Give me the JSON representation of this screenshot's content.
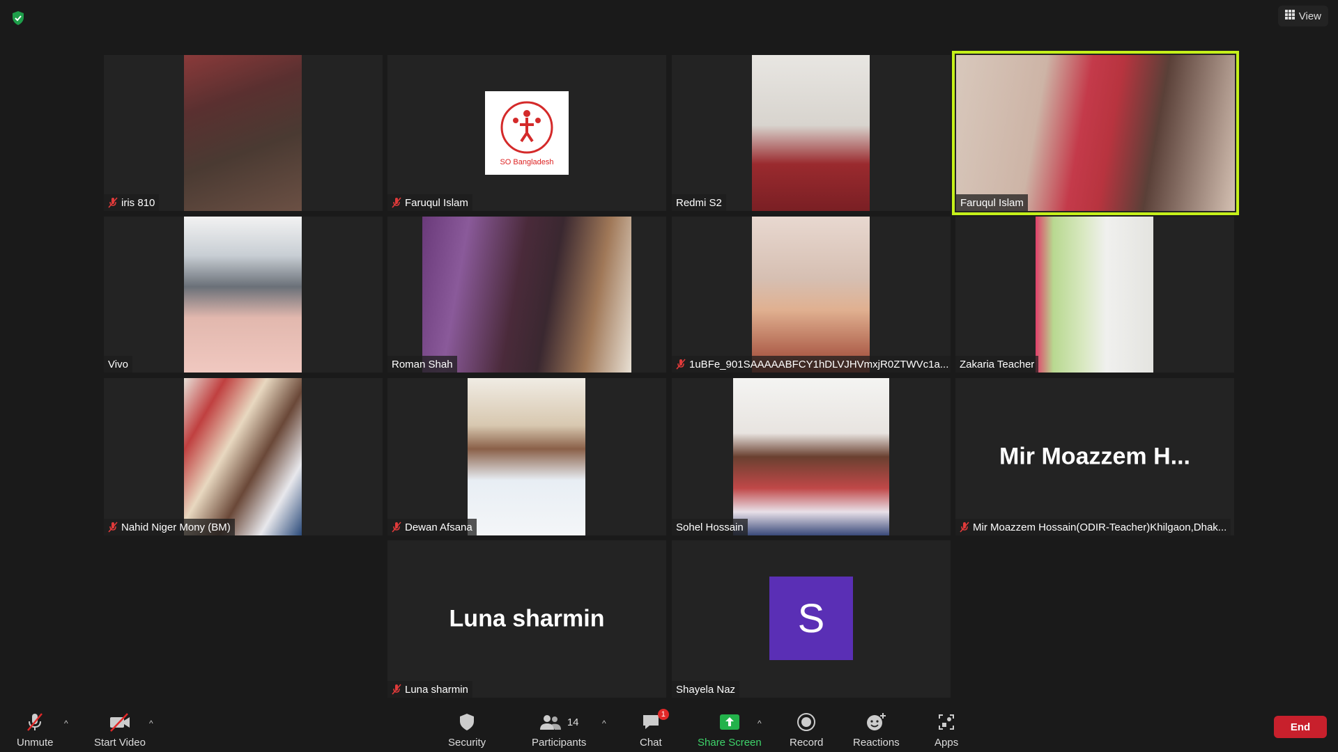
{
  "topbar": {
    "view_label": "View"
  },
  "tiles": [
    {
      "name": "iris 810"
    },
    {
      "name": "Faruqul Islam",
      "logo_text": "SO Bangladesh"
    },
    {
      "name": "Redmi S2"
    },
    {
      "name": "Faruqul Islam"
    },
    {
      "name": "Vivo"
    },
    {
      "name": "Roman Shah"
    },
    {
      "name": "1uBFe_901SAAAAABFCY1hDLVJHVmxjR0ZTWVc1a..."
    },
    {
      "name": "Zakaria Teacher"
    },
    {
      "name": "Nahid Niger Mony (BM)"
    },
    {
      "name": "Dewan Afsana"
    },
    {
      "name": "Sohel Hossain"
    },
    {
      "name": "Mir Moazzem Hossain(ODIR-Teacher)Khilgaon,Dhak...",
      "display_name": "Mir Moazzem H..."
    },
    {
      "name": "Luna sharmin",
      "display_name": "Luna sharmin"
    },
    {
      "name": "Shayela Naz",
      "avatar_letter": "S"
    }
  ],
  "toolbar": {
    "unmute": "Unmute",
    "start_video": "Start Video",
    "security": "Security",
    "participants": "Participants",
    "participants_count": "14",
    "chat": "Chat",
    "chat_badge": "1",
    "share_screen": "Share Screen",
    "record": "Record",
    "reactions": "Reactions",
    "apps": "Apps",
    "end": "End"
  },
  "colors": {
    "background": "#1a1a1a",
    "tile": "#232323",
    "active_speaker": "#c5f01a",
    "share_green": "#23b24b",
    "end_red": "#c8202c",
    "avatar_purple": "#5a2fb5"
  }
}
